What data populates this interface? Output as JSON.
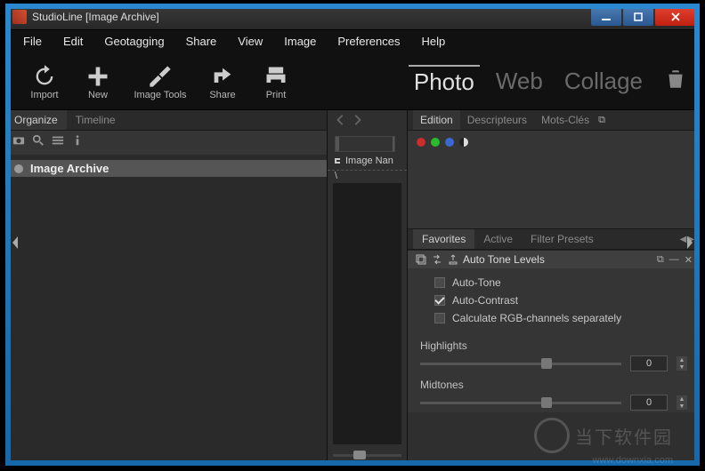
{
  "window": {
    "title": "StudioLine [Image Archive]"
  },
  "menubar": [
    "File",
    "Edit",
    "Geotagging",
    "Share",
    "View",
    "Image",
    "Preferences",
    "Help"
  ],
  "toolbar": {
    "import": "Import",
    "new": "New",
    "image_tools": "Image Tools",
    "share": "Share",
    "print": "Print"
  },
  "modes": {
    "photo": "Photo",
    "web": "Web",
    "collage": "Collage",
    "active": "photo"
  },
  "left": {
    "tabs": {
      "organize": "Organize",
      "timeline": "Timeline",
      "active": "organize"
    },
    "tree_item": "Image Archive"
  },
  "mid": {
    "image_name_label": "Image Nan",
    "path": "\\"
  },
  "right": {
    "tabs": {
      "edition": "Edition",
      "descripteurs": "Descripteurs",
      "mots_cles": "Mots-Clés",
      "active": "edition"
    }
  },
  "fav": {
    "tabs": {
      "favorites": "Favorites",
      "active_tab": "Active",
      "filter_presets": "Filter Presets",
      "selected": "favorites"
    }
  },
  "tool": {
    "title": "Auto Tone Levels",
    "auto_tone": "Auto-Tone",
    "auto_contrast": "Auto-Contrast",
    "rgb_sep": "Calculate RGB-channels separately",
    "auto_tone_checked": false,
    "auto_contrast_checked": true,
    "rgb_sep_checked": false,
    "highlights": {
      "label": "Highlights",
      "value": "0",
      "pos": 60
    },
    "midtones": {
      "label": "Midtones",
      "value": "0",
      "pos": 60
    }
  },
  "watermark": {
    "text": "当下软件园",
    "url": "www.downxia.com"
  }
}
